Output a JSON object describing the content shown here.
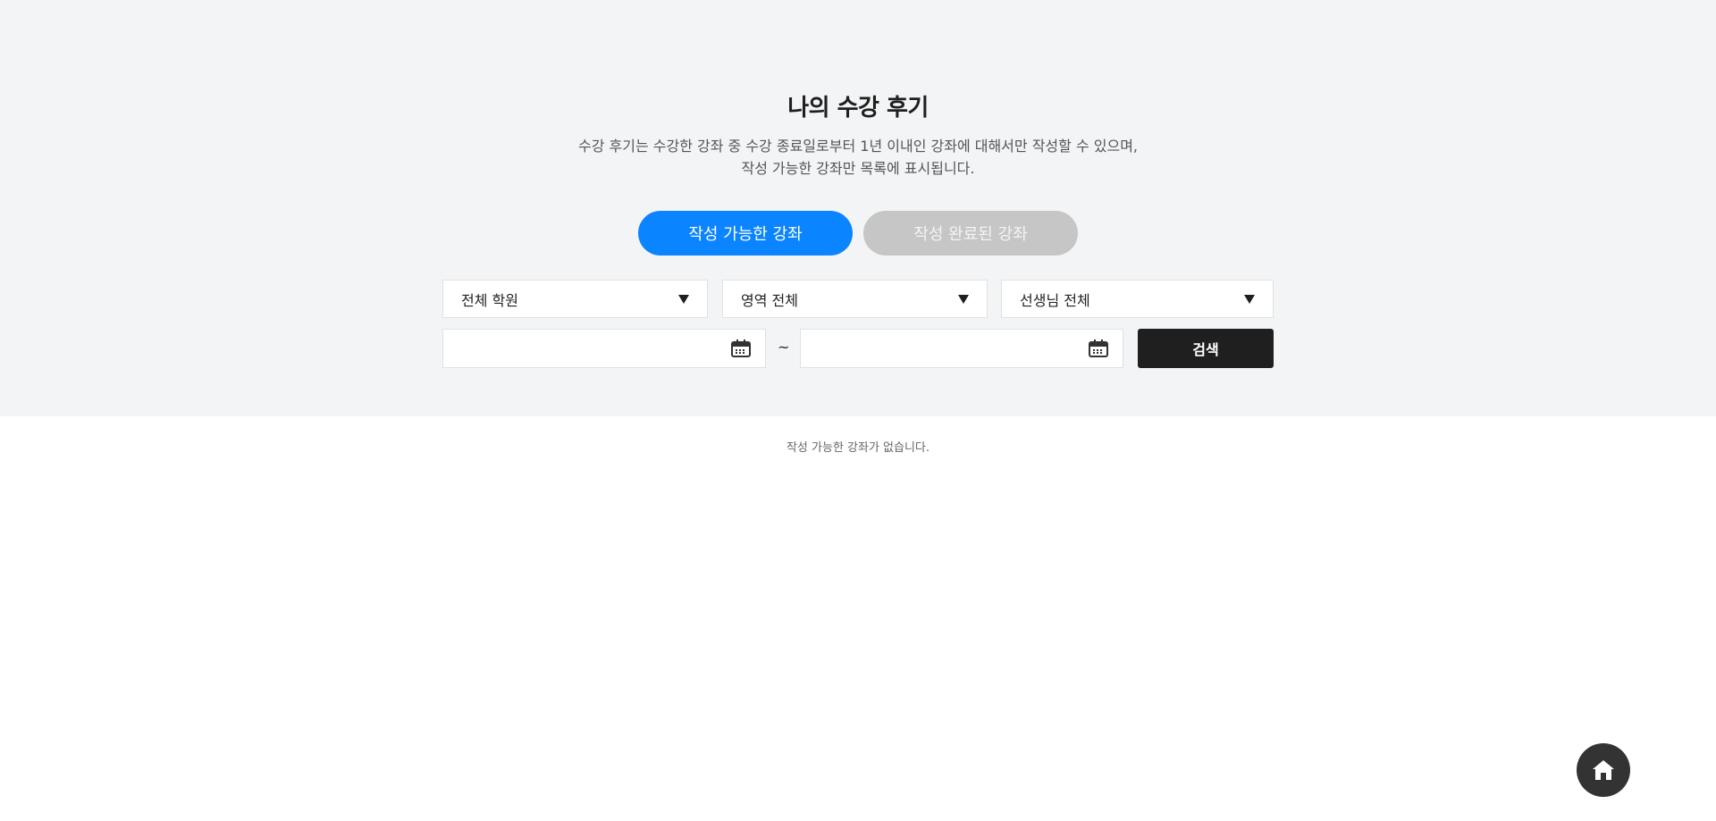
{
  "page": {
    "title": "나의 수강 후기",
    "description_line1": "수강 후기는 수강한 강좌 중 수강 종료일로부터 1년 이내인 강좌에 대해서만 작성할 수 있으며,",
    "description_line2": "작성 가능한 강좌만 목록에 표시됩니다."
  },
  "tabs": [
    {
      "label": "작성 가능한 강좌",
      "active": true
    },
    {
      "label": "작성 완료된 강좌",
      "active": false
    }
  ],
  "filters": {
    "academy": "전체 학원",
    "area": "영역 전체",
    "teacher": "선생님 전체"
  },
  "date_range": {
    "start_value": "",
    "end_value": "",
    "separator": "~",
    "icon": "calendar-icon"
  },
  "search": {
    "label": "검색"
  },
  "results": {
    "empty_message": "작성 가능한 강좌가 없습니다."
  },
  "fab": {
    "icon": "home-icon"
  },
  "colors": {
    "accent": "#0b84ff",
    "inactive_tab": "#c6c6c6",
    "search_button": "#1f1f1f",
    "top_background": "#f3f4f6"
  }
}
